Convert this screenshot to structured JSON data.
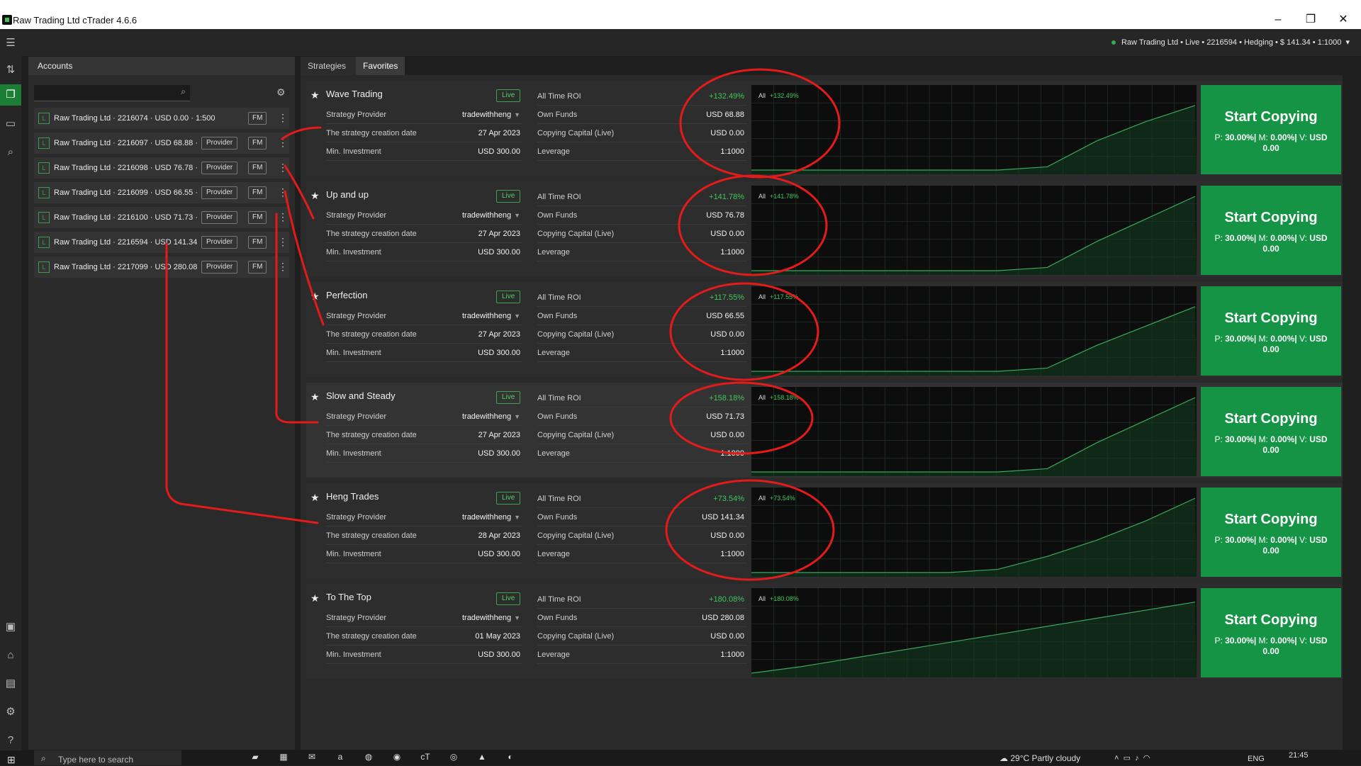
{
  "window": {
    "title": "Raw Trading Ltd cTrader 4.6.6",
    "minimize": "–",
    "restore": "❐",
    "close": "✕"
  },
  "header": {
    "account_info": "Raw Trading Ltd • Live • 2216594 • Hedging • $ 141.34 • 1:1000",
    "chevron": "▾"
  },
  "rail_icons": [
    "menu-icon",
    "trade-icon",
    "copy-icon",
    "analyze-icon",
    "search-icon",
    "briefcase-icon",
    "store-icon",
    "reports-icon",
    "settings-icon",
    "help-icon"
  ],
  "accounts": {
    "header": "Accounts",
    "search_placeholder": "",
    "badge": "L",
    "fm_label": "FM",
    "provider_label": "Provider",
    "items": [
      {
        "name": "Raw Trading Ltd · 2216074 · USD 0.00 · 1:500",
        "provider": false
      },
      {
        "name": "Raw Trading Ltd · 2216097 · USD 68.88 ·",
        "provider": true
      },
      {
        "name": "Raw Trading Ltd · 2216098 · USD 76.78 ·",
        "provider": true
      },
      {
        "name": "Raw Trading Ltd · 2216099 · USD 66.55 ·",
        "provider": true
      },
      {
        "name": "Raw Trading Ltd · 2216100 · USD 71.73 ·",
        "provider": true
      },
      {
        "name": "Raw Trading Ltd · 2216594 · USD 141.34",
        "provider": true
      },
      {
        "name": "Raw Trading Ltd · 2217099 · USD 280.08",
        "provider": true
      }
    ]
  },
  "tabs": {
    "strategies": "Strategies",
    "favorites": "Favorites",
    "favorites_count": "6"
  },
  "labels": {
    "provider": "Strategy Provider",
    "creation": "The strategy creation date",
    "min_invest": "Min. Investment",
    "roi": "All Time ROI",
    "own_funds": "Own Funds",
    "copying_capital": "Copying Capital (Live)",
    "leverage": "Leverage",
    "live": "Live",
    "chart_all": "All",
    "start": "Start Copying",
    "p": "P:",
    "m": "M:",
    "v": "V:"
  },
  "strategies": [
    {
      "name": "Wave Trading",
      "provider": "tradewithheng",
      "created": "27 Apr 2023",
      "min_invest": "USD 300.00",
      "roi": "+132.49%",
      "own_funds": "USD 68.88",
      "copying_capital": "USD 0.00",
      "leverage": "1:1000",
      "fee_p": "30.00%",
      "fee_m": "0.00%",
      "fee_v": "USD 0.00",
      "curve": [
        0,
        0,
        0,
        0,
        0,
        0,
        2,
        18,
        30,
        40
      ],
      "highlight": false
    },
    {
      "name": "Up and up",
      "provider": "tradewithheng",
      "created": "27 Apr 2023",
      "min_invest": "USD 300.00",
      "roi": "+141.78%",
      "own_funds": "USD 76.78",
      "copying_capital": "USD 0.00",
      "leverage": "1:1000",
      "fee_p": "30.00%",
      "fee_m": "0.00%",
      "fee_v": "USD 0.00",
      "curve": [
        0,
        0,
        0,
        0,
        0,
        0,
        2,
        18,
        32,
        46
      ],
      "highlight": false
    },
    {
      "name": "Perfection",
      "provider": "tradewithheng",
      "created": "27 Apr 2023",
      "min_invest": "USD 300.00",
      "roi": "+117.55%",
      "own_funds": "USD 66.55",
      "copying_capital": "USD 0.00",
      "leverage": "1:1000",
      "fee_p": "30.00%",
      "fee_m": "0.00%",
      "fee_v": "USD 0.00",
      "curve": [
        0,
        0,
        0,
        0,
        0,
        0,
        2,
        16,
        28,
        40
      ],
      "highlight": false
    },
    {
      "name": "Slow and Steady",
      "provider": "tradewithheng",
      "created": "27 Apr 2023",
      "min_invest": "USD 300.00",
      "roi": "+158.18%",
      "own_funds": "USD 71.73",
      "copying_capital": "USD 0.00",
      "leverage": "1:1000",
      "fee_p": "30.00%",
      "fee_m": "0.00%",
      "fee_v": "USD 0.00",
      "curve": [
        0,
        0,
        0,
        0,
        0,
        0,
        2,
        18,
        32,
        46
      ],
      "highlight": true
    },
    {
      "name": "Heng Trades",
      "provider": "tradewithheng",
      "created": "28 Apr 2023",
      "min_invest": "USD 300.00",
      "roi": "+73.54%",
      "own_funds": "USD 141.34",
      "copying_capital": "USD 0.00",
      "leverage": "1:1000",
      "fee_p": "30.00%",
      "fee_m": "0.00%",
      "fee_v": "USD 0.00",
      "curve": [
        0,
        0,
        0,
        0,
        0,
        2,
        10,
        20,
        32,
        46
      ],
      "highlight": false
    },
    {
      "name": "To The Top",
      "provider": "tradewithheng",
      "created": "01 May 2023",
      "min_invest": "USD 300.00",
      "roi": "+180.08%",
      "own_funds": "USD 280.08",
      "copying_capital": "USD 0.00",
      "leverage": "1:1000",
      "fee_p": "30.00%",
      "fee_m": "0.00%",
      "fee_v": "USD 0.00",
      "curve": [
        0,
        4,
        9,
        14,
        19,
        24,
        29,
        34,
        39,
        44
      ],
      "highlight": false
    }
  ],
  "colors": {
    "brand_green": "#149444",
    "roi_green": "#3ec95a",
    "chart_line": "#3aa85a",
    "annotation_red": "#e31b1b"
  },
  "taskbar": {
    "search_placeholder": "Type here to search",
    "weather": "29°C  Partly cloudy",
    "lang": "ENG",
    "time": "21:45",
    "apps": [
      "explorer-icon",
      "store-icon",
      "mail-icon",
      "amazon-icon",
      "photos-icon",
      "chrome-icon",
      "ctrader-icon",
      "globe-icon",
      "drive-icon",
      "edge-icon"
    ]
  }
}
